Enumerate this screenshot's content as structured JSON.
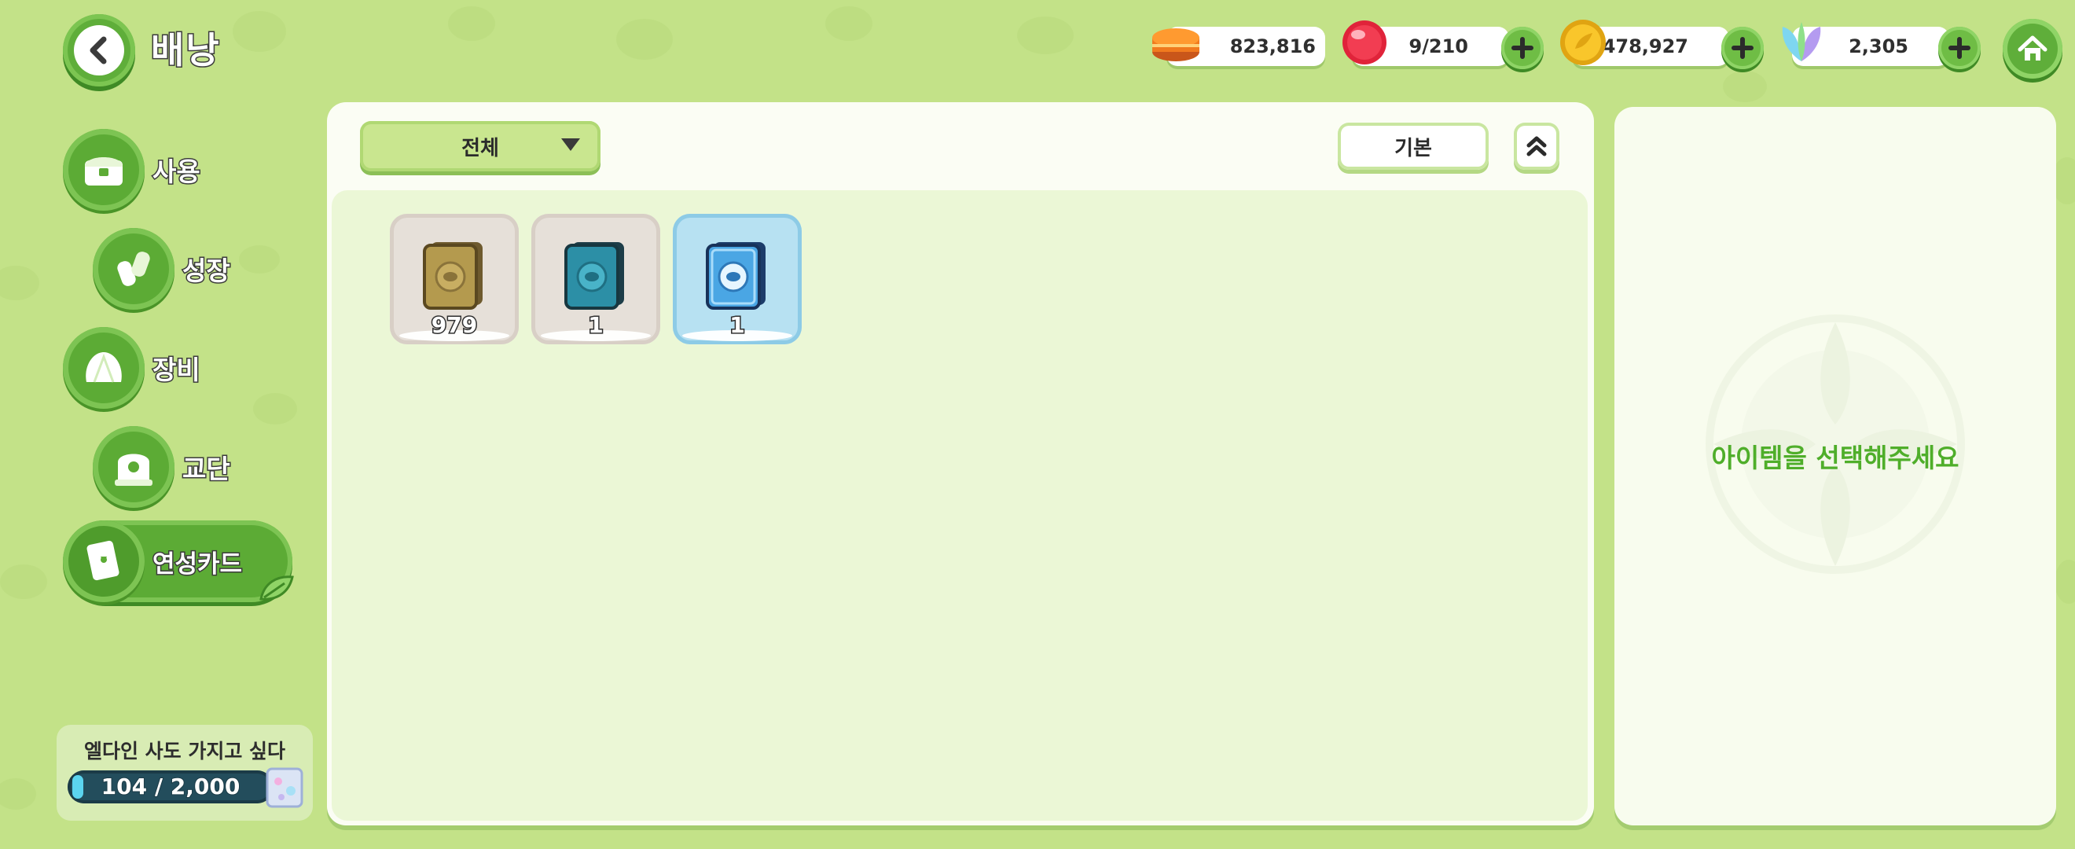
{
  "header": {
    "title": "배낭",
    "resources": [
      {
        "name": "bread",
        "icon": "orange-macaron-icon",
        "value": "823,816",
        "has_plus": false
      },
      {
        "name": "stamina",
        "icon": "red-jelly-icon",
        "value": "9/210",
        "has_plus": true
      },
      {
        "name": "coins",
        "icon": "gold-coin-icon",
        "value": "26,478,927",
        "has_plus": true
      },
      {
        "name": "crystal",
        "icon": "leaf-crystal-icon",
        "value": "2,305",
        "has_plus": true
      }
    ]
  },
  "sidebar": {
    "items": [
      {
        "label": "사용",
        "icon": "chest-icon",
        "active": false
      },
      {
        "label": "성장",
        "icon": "potion-icon",
        "active": false
      },
      {
        "label": "장비",
        "icon": "shell-icon",
        "active": false
      },
      {
        "label": "교단",
        "icon": "temple-icon",
        "active": false
      },
      {
        "label": "연성카드",
        "icon": "card-icon",
        "active": true
      }
    ]
  },
  "quest": {
    "title": "엘다인 사도 가지고 싶다",
    "progress_text": "104 / 2,000",
    "progress": 0.052
  },
  "toolbar": {
    "filter": "전체",
    "sort": "기본"
  },
  "items": [
    {
      "count": "979",
      "style": "gold-card",
      "selected": false
    },
    {
      "count": "1",
      "style": "teal-card",
      "selected": false
    },
    {
      "count": "1",
      "style": "blue-card",
      "selected": true
    }
  ],
  "detail": {
    "hint": "아이템을 선택해주세요"
  },
  "colors": {
    "background": "#c3e288",
    "accent_green": "#5cab35",
    "hint_green": "#4fae2a"
  }
}
